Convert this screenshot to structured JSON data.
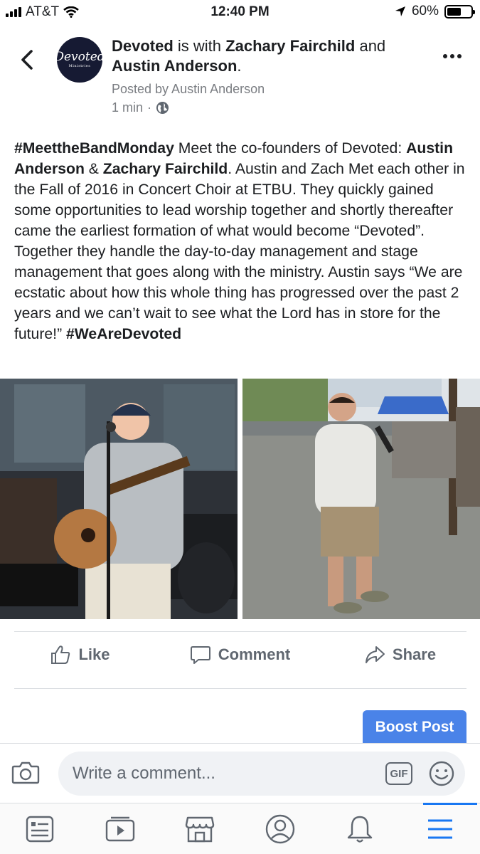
{
  "status_bar": {
    "carrier": "AT&T",
    "time": "12:40 PM",
    "battery": "60%",
    "battery_level": 0.6
  },
  "post": {
    "page_name": "Devoted",
    "with_text": " is with ",
    "tag1": "Zachary Fairchild",
    "and_text": " and ",
    "tag2": "Austin Anderson",
    "tag_end": ".",
    "avatar_text": "Devoted",
    "avatar_subtext": "Ministries",
    "posted_by": "Posted by Austin Anderson",
    "time": "1 min",
    "dot": "·",
    "body": {
      "hashtag1": "#MeettheBandMonday",
      "t1": " Meet the co-founders of Devoted: ",
      "name1": "Austin Anderson",
      "amp": " & ",
      "name2": "Zachary Fairchild",
      "t2": ". Austin and Zach Met each other in the Fall of 2016 in Concert Choir at ETBU. They quickly gained some opportunities to lead worship together and shortly thereafter came the earliest formation of what would become “Devoted”. Together they handle the day-to-day management and stage management that goes along with the ministry. Austin says “We are ecstatic about how this whole thing has progressed over the past 2 years and we can’t wait to see what the Lord has in store for the future!” ",
      "hashtag2": "#WeAreDevoted"
    }
  },
  "actions": {
    "like": "Like",
    "comment": "Comment",
    "share": "Share"
  },
  "boost": "Boost Post",
  "comment_placeholder": "Write a comment...",
  "gif": "GIF",
  "tabs": [
    "news-feed",
    "watch",
    "marketplace",
    "profile",
    "notifications",
    "menu"
  ]
}
